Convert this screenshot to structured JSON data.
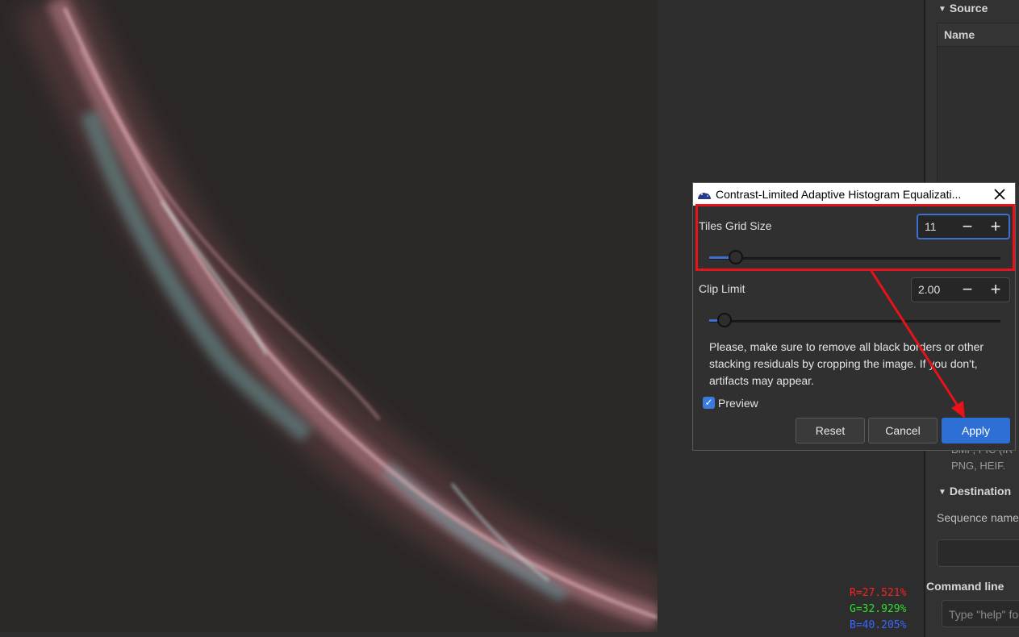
{
  "dialog": {
    "title": "Contrast-Limited Adaptive Histogram Equalizati...",
    "close_icon": "close-icon",
    "title_icon": "siril-app-icon",
    "tiles_grid_size": {
      "label": "Tiles Grid Size",
      "value": "11",
      "slider_fraction": 0.07
    },
    "clip_limit": {
      "label": "Clip Limit",
      "value": "2.00",
      "slider_fraction": 0.03
    },
    "warning_text": "Please, make sure to remove all black borders or other stacking residuals by cropping the image. If you don't, artifacts may appear.",
    "preview": {
      "label": "Preview",
      "checked": true
    },
    "buttons": {
      "reset": "Reset",
      "cancel": "Cancel",
      "apply": "Apply"
    },
    "minus_glyph": "−",
    "plus_glyph": "+"
  },
  "right_panel": {
    "source_header": "Source",
    "source_column": "Name",
    "formats_line1": "BMP, PIC (IR",
    "formats_line2": "PNG, HEIF.",
    "destination_header": "Destination",
    "sequence_name_label": "Sequence name",
    "command_line_label": "Command line",
    "command_placeholder": "Type \"help\" fo"
  },
  "pixel_values": {
    "r": "R=27.521%",
    "g": "G=32.929%",
    "b": "B=40.205%"
  },
  "colors": {
    "accent": "#2e6fd6",
    "annotation": "#e8121a",
    "r_text": "#ff2020",
    "g_text": "#2de02d",
    "b_text": "#3a66ff"
  }
}
